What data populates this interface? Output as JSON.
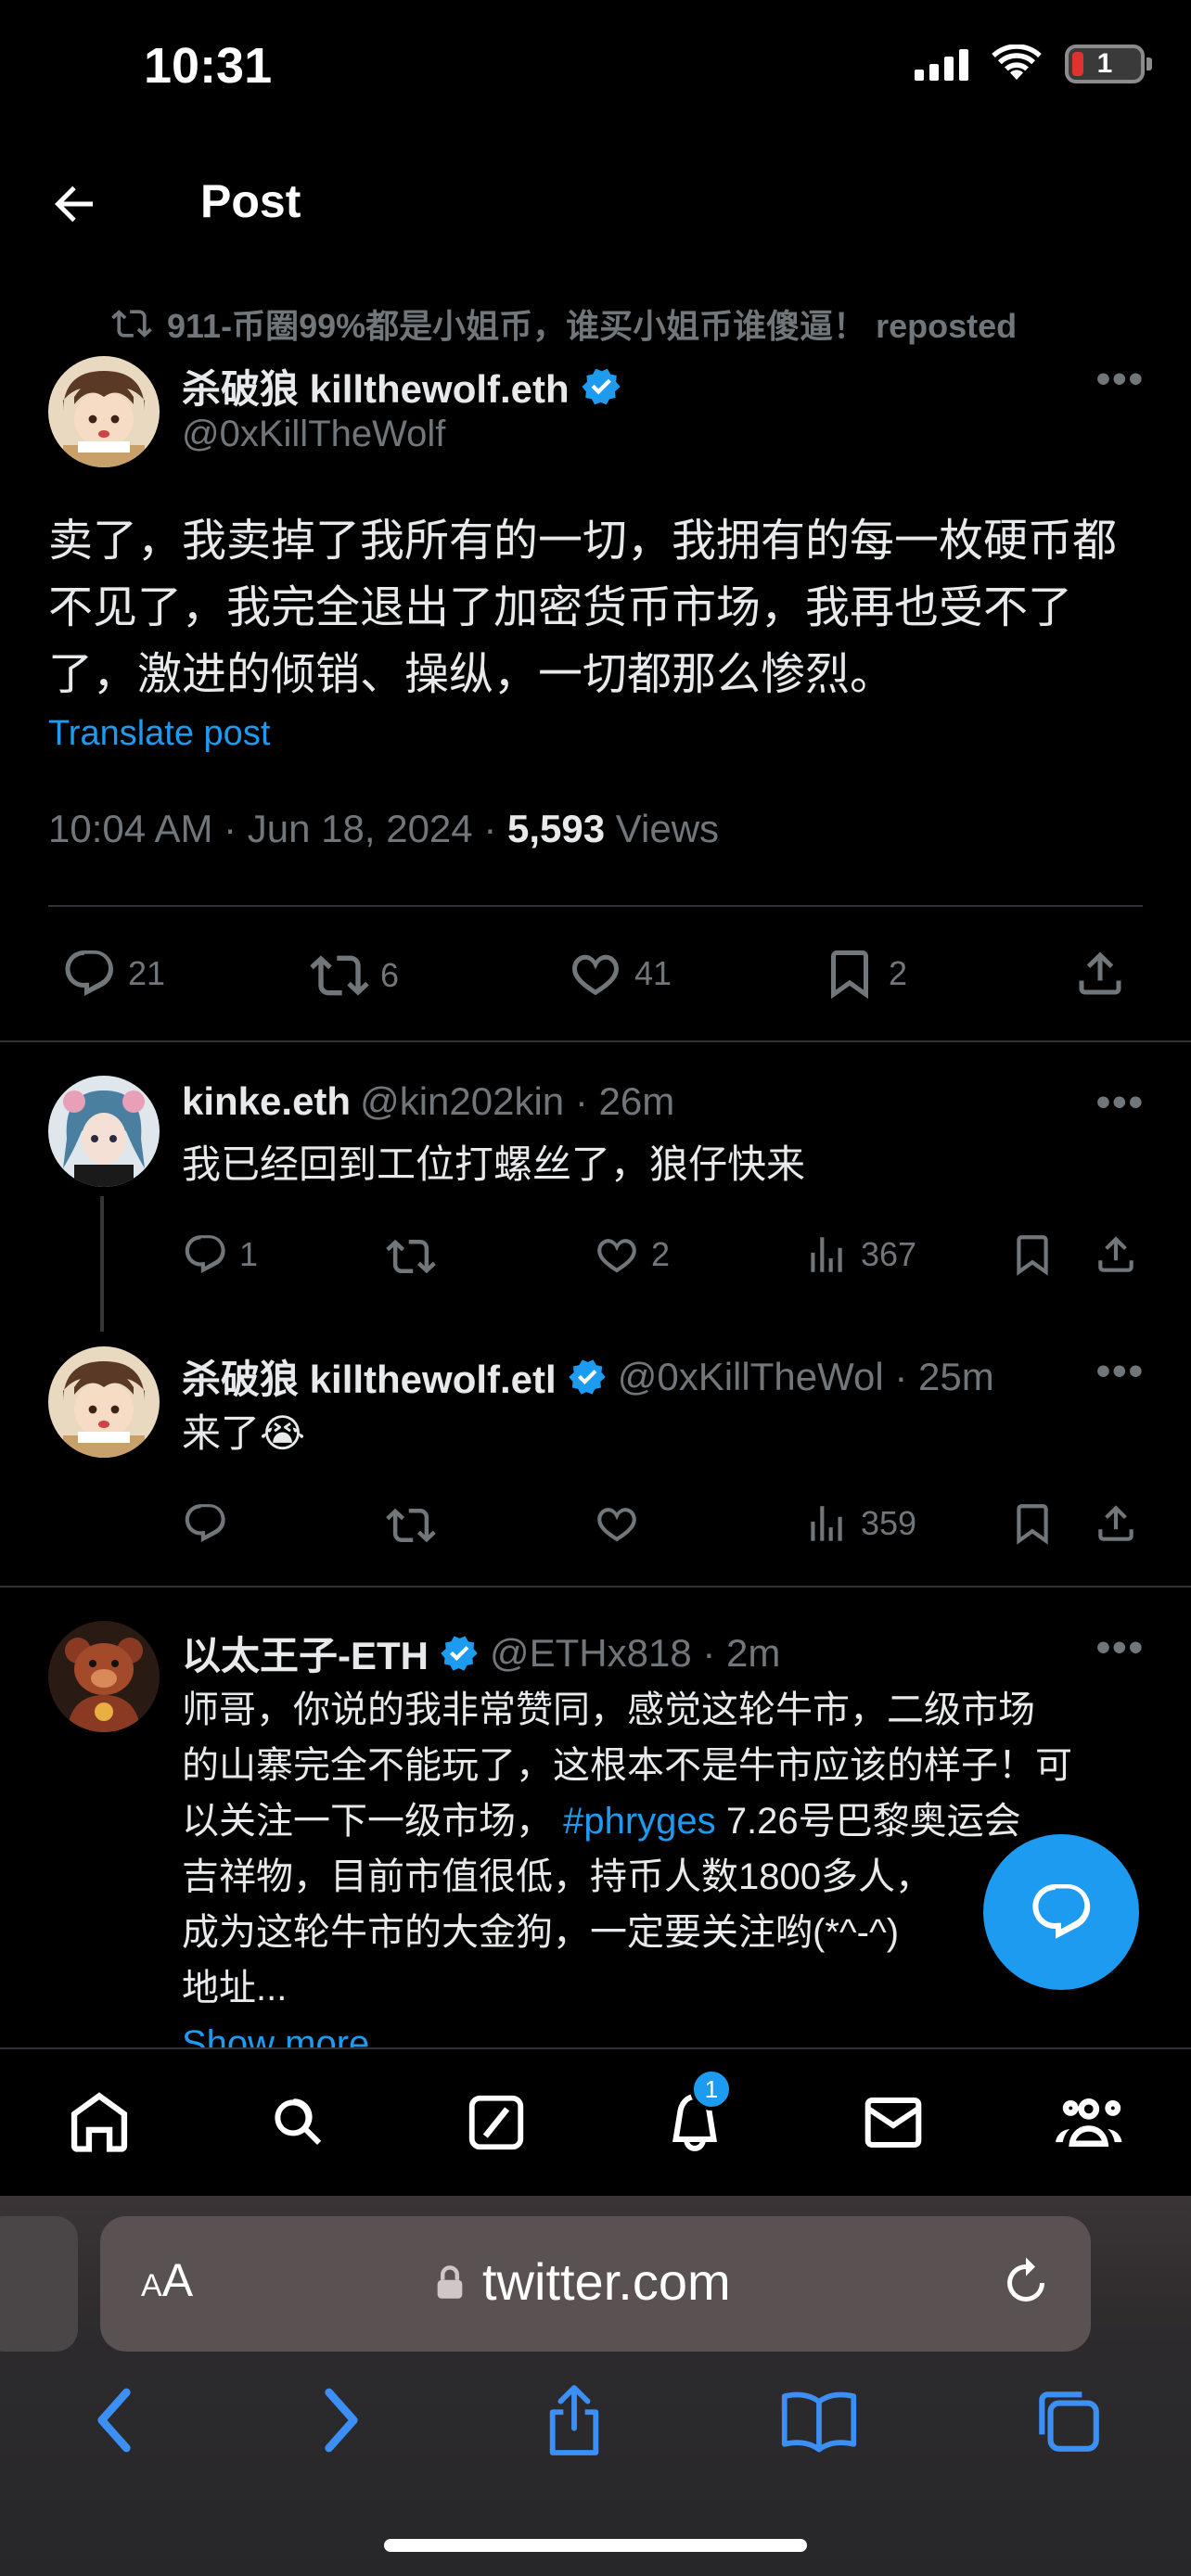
{
  "status_bar": {
    "time": "10:31",
    "battery": "1"
  },
  "header": {
    "title": "Post"
  },
  "repost": {
    "text": "911-币圈99%都是小姐币，谁买小姐币谁傻逼！ reposted"
  },
  "post": {
    "display_name": "杀破狼 killthewolf.eth",
    "handle": "@0xKillTheWolf",
    "text": "卖了，我卖掉了我所有的一切，我拥有的每一枚硬币都不见了，我完全退出了加密货币市场，我再也受不了了，激进的倾销、操纵，一切都那么惨烈。",
    "translate": "Translate post",
    "timestamp": "10:04 AM · Jun 18, 2024 · ",
    "views_count": "5,593",
    "views_label": " Views",
    "replies": "21",
    "reposts": "6",
    "likes": "41",
    "bookmarks": "2"
  },
  "replies": [
    {
      "display_name": "kinke.eth",
      "meta": "@kin202kin · 26m",
      "text": "我已经回到工位打螺丝了，狼仔快来",
      "replies": "1",
      "reposts": "",
      "likes": "2",
      "views": "367"
    },
    {
      "display_name": "杀破狼 killthewolf.etl",
      "meta": "@0xKillTheWol · 25m",
      "text": "来了😭",
      "replies": "",
      "reposts": "",
      "likes": "",
      "views": "359"
    },
    {
      "display_name": "以太王子-ETH",
      "meta": "@ETHx818 · 2m",
      "lines": [
        "师哥，你说的我非常赞同，感觉这轮牛市，二级市场",
        "的山寨完全不能玩了，这根本不是牛市应该的样子！可",
        "以关注一下一级市场，",
        "吉祥物，目前市值很低，持币人数1800多人，",
        "成为这轮牛市的大金狗，一定要关注哟(*^-^)",
        "地址..."
      ],
      "hashtag": "#phryges",
      "line3_tail": "7.26号巴黎奥运会",
      "show_more": "Show more"
    }
  ],
  "tabbar": {
    "notification_count": "1"
  },
  "safari": {
    "aa_small": "A",
    "aa_large": "A",
    "domain": "twitter.com"
  },
  "colors": {
    "accent": "#1d9bf0",
    "background": "#000000",
    "muted": "#71767b",
    "text": "#e7e9ea",
    "divider": "#2f3336"
  },
  "icons": [
    "back-arrow-icon",
    "repost-icon",
    "verified-icon",
    "more-icon",
    "reply-icon",
    "like-icon",
    "bookmark-icon",
    "share-icon",
    "views-icon",
    "compose-reply-icon",
    "home-icon",
    "search-icon",
    "grok-icon",
    "notifications-icon",
    "messages-icon",
    "communities-icon",
    "lock-icon",
    "reload-icon",
    "tabs-icon"
  ]
}
